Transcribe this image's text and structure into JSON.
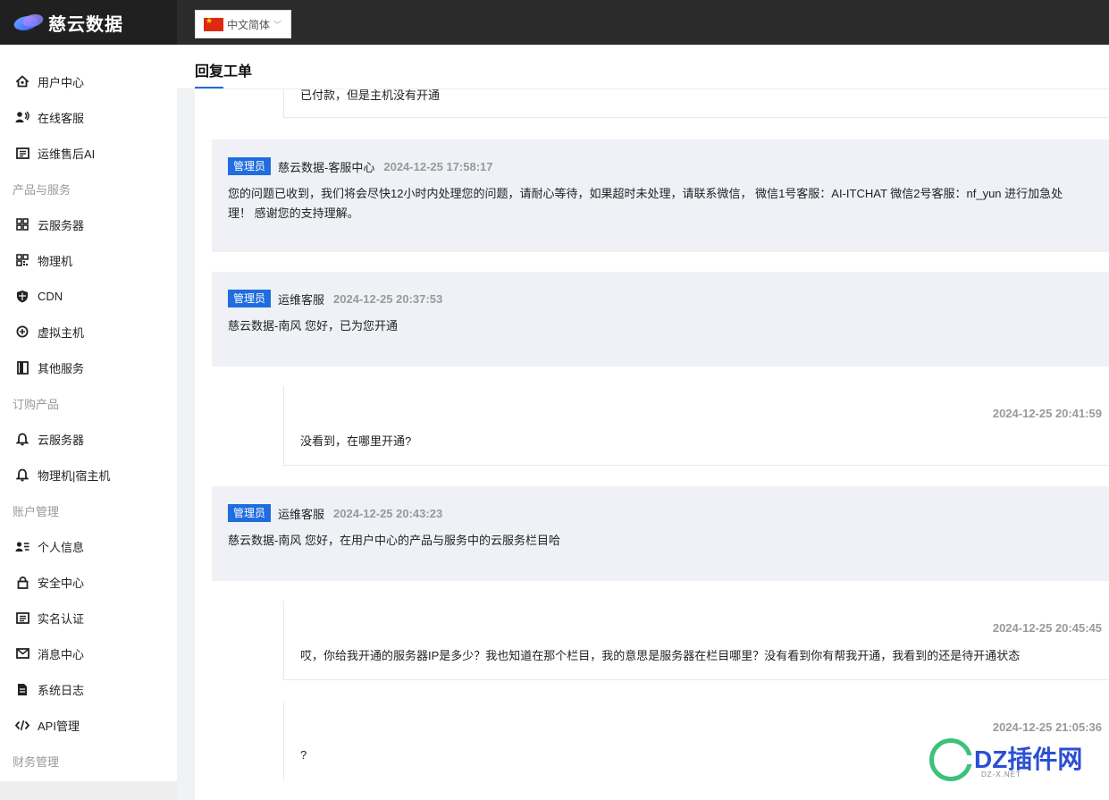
{
  "brand": {
    "name": "慈云数据"
  },
  "language": {
    "label": "中文简体"
  },
  "sidebar": {
    "groups": [
      {
        "title": "",
        "items": [
          {
            "label": "用户中心",
            "icon": "home-icon"
          },
          {
            "label": "在线客服",
            "icon": "headset-icon"
          },
          {
            "label": "运维售后AI",
            "icon": "document-icon"
          }
        ]
      },
      {
        "title": "产品与服务",
        "items": [
          {
            "label": "云服务器",
            "icon": "grid-icon"
          },
          {
            "label": "物理机",
            "icon": "qrcode-icon"
          },
          {
            "label": "CDN",
            "icon": "shield-icon"
          },
          {
            "label": "虚拟主机",
            "icon": "cube-icon"
          },
          {
            "label": "其他服务",
            "icon": "book-icon"
          }
        ]
      },
      {
        "title": "订购产品",
        "items": [
          {
            "label": "云服务器",
            "icon": "bell-icon"
          },
          {
            "label": "物理机|宿主机",
            "icon": "bell-icon"
          }
        ]
      },
      {
        "title": "账户管理",
        "items": [
          {
            "label": "个人信息",
            "icon": "user-card-icon"
          },
          {
            "label": "安全中心",
            "icon": "lock-icon"
          },
          {
            "label": "实名认证",
            "icon": "id-card-icon"
          },
          {
            "label": "消息中心",
            "icon": "mail-icon"
          },
          {
            "label": "系统日志",
            "icon": "file-icon"
          },
          {
            "label": "API管理",
            "icon": "code-icon"
          }
        ]
      },
      {
        "title": "财务管理",
        "items": []
      }
    ]
  },
  "page": {
    "title": "回复工单"
  },
  "messages": {
    "m0": {
      "text": "已付款，但是主机没有开通"
    },
    "m1": {
      "badge": "管理员",
      "sender": "慈云数据-客服中心",
      "time": "2024-12-25 17:58:17",
      "text": "您的问题已收到，我们将会尽快12小时内处理您的问题，请耐心等待，如果超时未处理，请联系微信， 微信1号客服：AI-ITCHAT 微信2号客服：nf_yun 进行加急处\n理！ 感谢您的支持理解。"
    },
    "m2": {
      "badge": "管理员",
      "sender": "运维客服",
      "time": "2024-12-25 20:37:53",
      "text": "慈云数据-南风 您好，已为您开通"
    },
    "m3": {
      "time": "2024-12-25 20:41:59",
      "text": "没看到，在哪里开通?"
    },
    "m4": {
      "badge": "管理员",
      "sender": "运维客服",
      "time": "2024-12-25 20:43:23",
      "text": "慈云数据-南风 您好，在用户中心的产品与服务中的云服务栏目哈"
    },
    "m5": {
      "time": "2024-12-25 20:45:45",
      "text": "哎，你给我开通的服务器IP是多少？我也知道在那个栏目，我的意思是服务器在栏目哪里？没有看到你有帮我开通，我看到的还是待开通状态"
    },
    "m6": {
      "time": "2024-12-25 21:05:36",
      "text": "?"
    }
  },
  "watermark": {
    "text": "DZ插件网",
    "sub": "DZ-X.NET"
  },
  "colors": {
    "accent": "#1f6dde",
    "topbar": "#2b2b2b",
    "admin_bg": "#eff1f6"
  }
}
